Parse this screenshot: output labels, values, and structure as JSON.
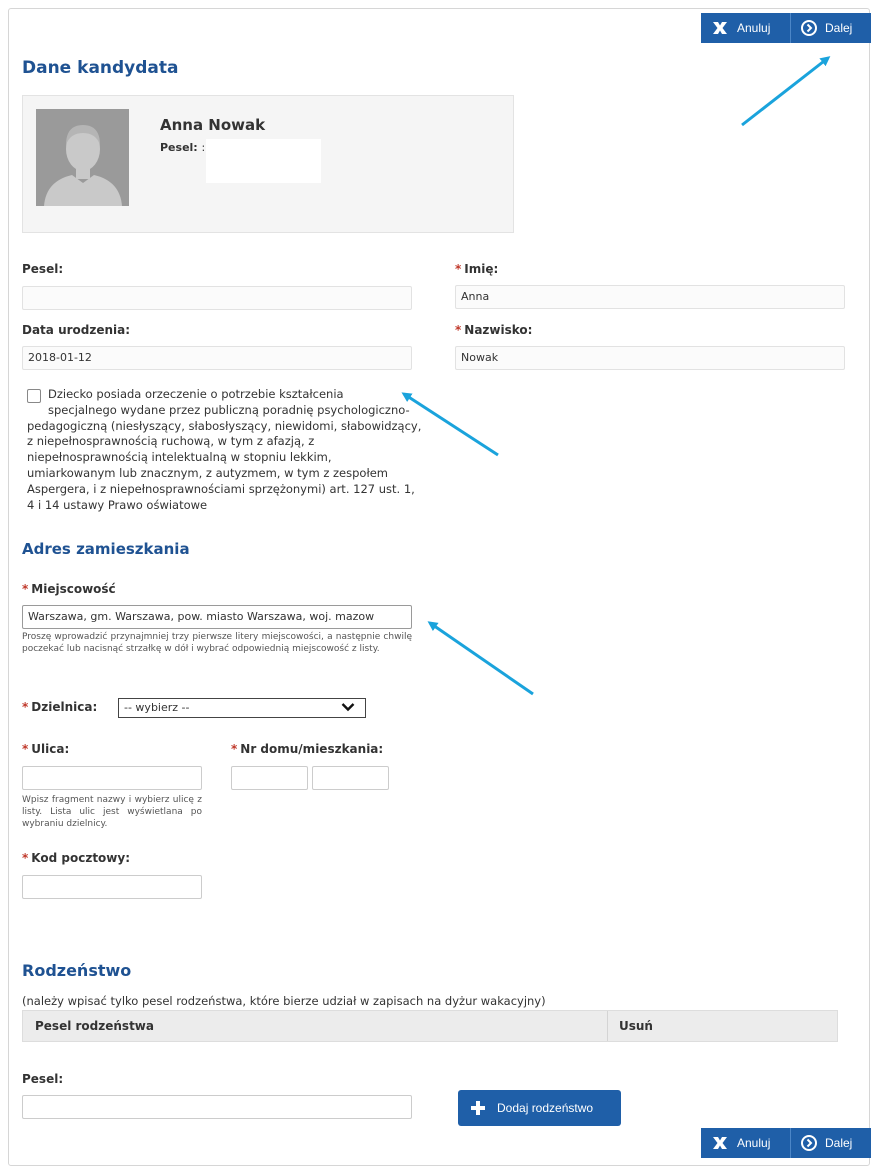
{
  "toolbar": {
    "cancel_label": "Anuluj",
    "next_label": "Dalej"
  },
  "candidate": {
    "title": "Dane kandydata",
    "name": "Anna Nowak",
    "pesel_label": "Pesel:",
    "pesel_value": ":"
  },
  "form": {
    "pesel_label": "Pesel:",
    "pesel_value": "",
    "first_name_label": "Imię:",
    "first_name_value": "Anna",
    "birth_date_label": "Data urodzenia:",
    "birth_date_value": "2018-01-12",
    "last_name_label": "Nazwisko:",
    "last_name_value": "Nowak",
    "required_mark": "*",
    "special_needs_line1": "Dziecko posiada orzeczenie o potrzebie kształcenia",
    "special_needs_rest": "specjalnego wydane przez publiczną poradnię psychologiczno-pedagogiczną (niesłyszący, słabosłyszący, niewidomi, słabowidzący, z niepełnosprawnością ruchową, w tym z afazją, z niepełnosprawnością intelektualną w stopniu lekkim, umiarkowanym lub znacznym, z autyzmem, w tym z zespołem Aspergera, i z niepełnosprawnościami sprzężonymi) art. 127 ust. 1, 4 i 14 ustawy Prawo oświatowe"
  },
  "address": {
    "title": "Adres zamieszkania",
    "city_label": "Miejscowość",
    "city_value": "Warszawa, gm. Warszawa, pow. miasto Warszawa, woj. mazow",
    "city_hint": "Proszę wprowadzić przynajmniej trzy pierwsze litery miejscowości, a następnie chwilę poczekać lub nacisnąć strzałkę w dół i wybrać odpowiednią miejscowość z listy.",
    "district_label": "Dzielnica:",
    "district_value": "-- wybierz --",
    "street_label": "Ulica:",
    "street_value": "",
    "street_hint": "Wpisz fragment nazwy i wybierz ulicę z listy. Lista ulic jest wyświetlana po wybraniu dzielnicy.",
    "house_label": "Nr domu/mieszkania:",
    "postal_label": "Kod pocztowy:"
  },
  "siblings": {
    "title": "Rodzeństwo",
    "note": "(należy wpisać tylko pesel rodzeństwa, które bierze udział w zapisach na dyżur wakacyjny)",
    "col_pesel": "Pesel rodzeństwa",
    "col_remove": "Usuń",
    "pesel_label": "Pesel:",
    "add_label": "Dodaj rodzeństwo"
  },
  "colors": {
    "primary": "#1f5fa8",
    "heading": "#1f5292",
    "required": "#c0392b",
    "annotation_arrow": "#1aa3dc"
  }
}
